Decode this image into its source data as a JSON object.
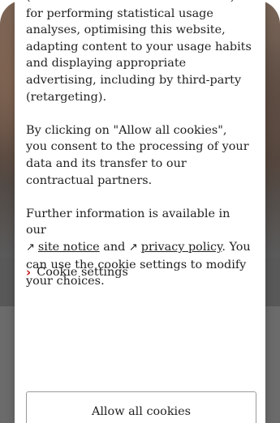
{
  "consent": {
    "paragraph1_top": "(hereinafter referred to as cookies) for performing statistical usage analyses, optimising this website, adapting content to your usage habits and displaying appropriate advertising, including by third-party (retargeting).",
    "paragraph2": "By clicking on \"Allow all cookies\", you consent to the processing of your data and its transfer to our contractual partners.",
    "paragraph3_intro": "Further information is available in our",
    "site_notice_link": "site notice",
    "and_text": "and",
    "privacy_policy_link": "privacy policy",
    "paragraph3_outro": ". You can use the cookie settings to modify your choices.",
    "cookie_settings_label": "Cookie settings",
    "allow_all_label": "Allow all cookies"
  },
  "icons": {
    "external_link": "arrow-up-right-icon",
    "settings_chevron": "chevron-right-icon"
  },
  "colors": {
    "accent": "#c4161c",
    "text": "#1f1f1f",
    "backdrop": "#6e6e6e"
  }
}
